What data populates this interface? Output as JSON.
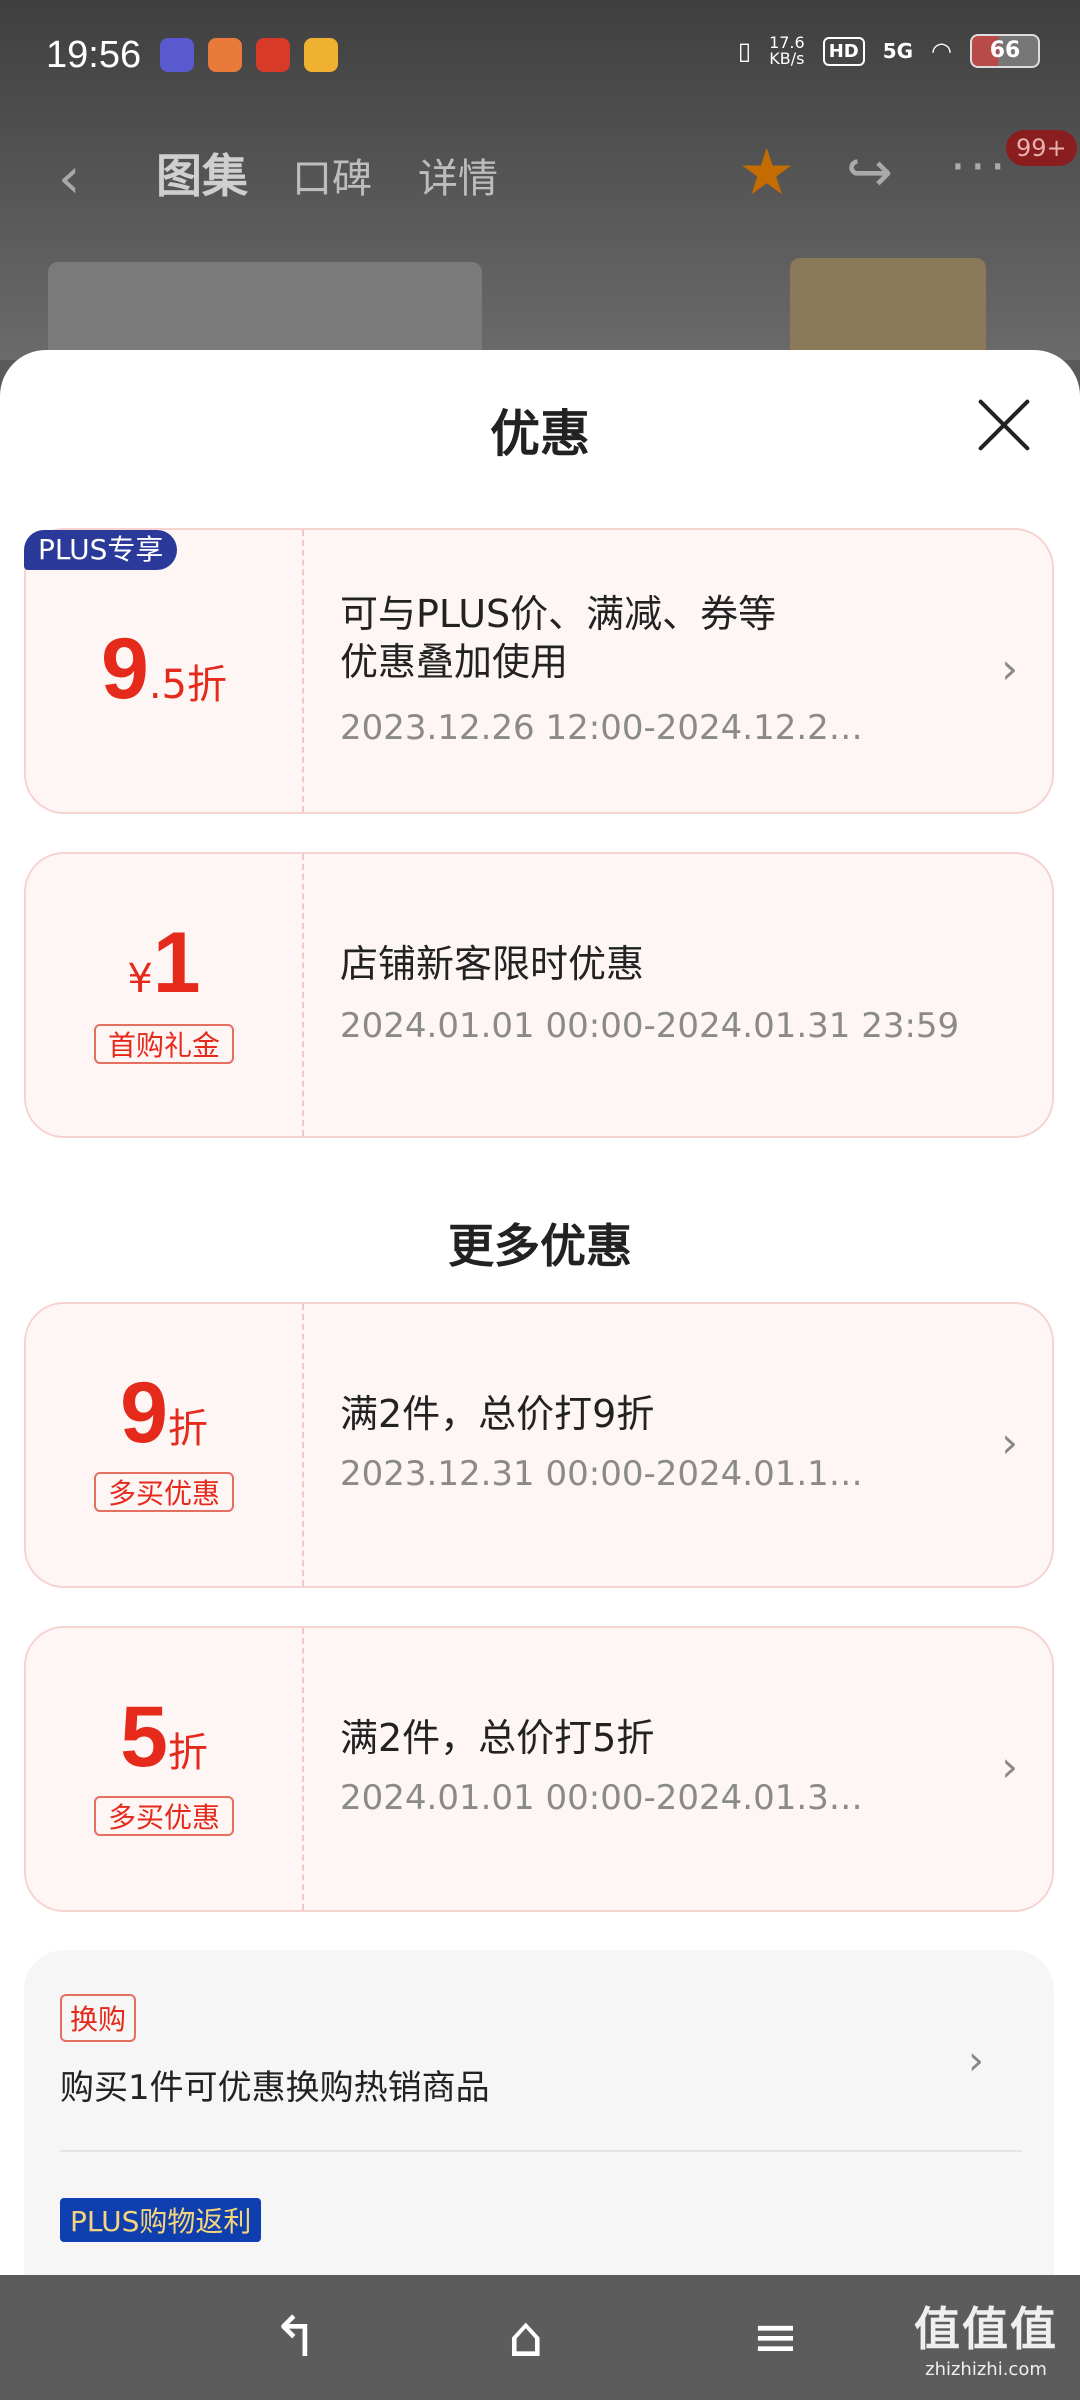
{
  "status_bar": {
    "time": "19:56",
    "net_speed_value": "17.6",
    "net_speed_unit": "KB/s",
    "hd": "HD",
    "network": "5G",
    "battery": "66"
  },
  "nav": {
    "back_icon": "chevron-left-icon",
    "tabs": [
      "图集",
      "口碑",
      "详情"
    ],
    "badge": "99+"
  },
  "sheet": {
    "title": "优惠",
    "close_icon": "close-icon"
  },
  "coupons": [
    {
      "badge": "PLUS专享",
      "value_main": "9",
      "value_sub": ".5折",
      "title_line1": "可与PLUS价、满减、券等",
      "title_line2": "优惠叠加使用",
      "date": "2023.12.26 12:00-2024.12.2…"
    },
    {
      "value_prefix": "¥",
      "value_main": "1",
      "tag": "首购礼金",
      "title": "店铺新客限时优惠",
      "date": "2024.01.01 00:00-2024.01.31 23:59"
    }
  ],
  "more_section_title": "更多优惠",
  "more_coupons": [
    {
      "value_main": "9",
      "value_sub": "折",
      "tag": "多买优惠",
      "title": "满2件，总价打9折",
      "date": "2023.12.31 00:00-2024.01.1…"
    },
    {
      "value_main": "5",
      "value_sub": "折",
      "tag": "多买优惠",
      "title": "满2件，总价打5折",
      "date": "2024.01.01 00:00-2024.01.3…"
    }
  ],
  "exchange": {
    "tag": "换购",
    "text": "购买1件可优惠换购热销商品"
  },
  "plus_rebate": {
    "tag": "PLUS购物返利"
  },
  "watermark": {
    "logo": "值值值",
    "url": "zhizhizhi.com"
  }
}
